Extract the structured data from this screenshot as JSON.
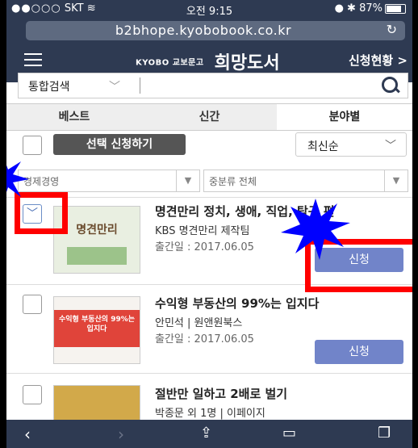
{
  "status_bar": {
    "carrier": "SKT",
    "time": "오전 9:15",
    "battery": "87%"
  },
  "browser": {
    "url": "b2bhope.kyobobook.co.kr"
  },
  "header": {
    "logo_small": "KYOBO 교보문고",
    "logo_title": "희망도서",
    "link": "신청현황 >"
  },
  "search": {
    "scope": "통합검색",
    "placeholder": ""
  },
  "tabs": [
    {
      "label": "베스트",
      "active": false
    },
    {
      "label": "신간",
      "active": false
    },
    {
      "label": "분야별",
      "active": true
    }
  ],
  "actions": {
    "select_apply_label": "선택 신청하기",
    "sort": "최신순"
  },
  "filters": {
    "category": "경제경영",
    "subcategory": "중분류 전체"
  },
  "books": [
    {
      "title": "명견만리 정치, 생애, 직업, 탐구 편",
      "author": "KBS 명견만리 제작팀",
      "date": "출간일 : 2017.06.05",
      "apply_label": "신청",
      "checked": true,
      "thumb_text": "명견만리"
    },
    {
      "title": "수익형 부동산의 99%는 입지다",
      "author": "안민석 | 원앤원북스",
      "date": "출간일 : 2017.06.05",
      "apply_label": "신청",
      "checked": false,
      "thumb_text": "수익형 부동산의 99%는 입지다"
    },
    {
      "title": "절반만 일하고 2배로 벌기",
      "author": "박종문 외 1명 | 이페이지",
      "date": "",
      "apply_label": "",
      "checked": false,
      "thumb_text": ""
    }
  ],
  "colors": {
    "header_bg": "#2e3a52",
    "apply_btn": "#7184c9",
    "annotation_red": "#ff0000",
    "annotation_burst": "#0000ff"
  }
}
